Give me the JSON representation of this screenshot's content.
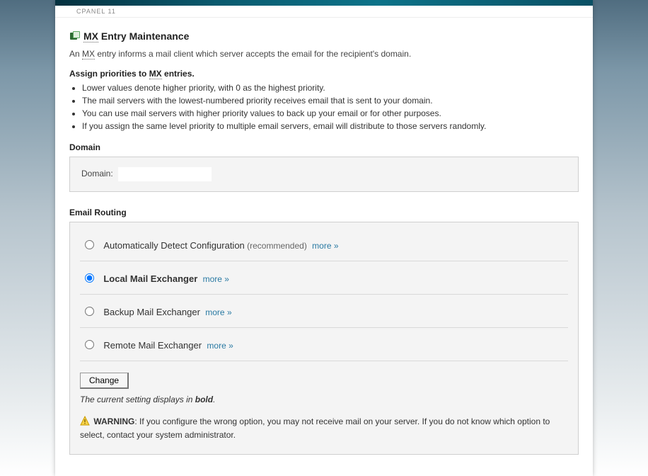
{
  "header": {
    "subbar": "CPANEL 11"
  },
  "title": {
    "prefix": "MX",
    "rest": " Entry Maintenance"
  },
  "intro": {
    "before": "An ",
    "mx": "MX",
    "after": " entry informs a mail client which server accepts the email for the recipient's domain."
  },
  "priorities": {
    "heading_before": "Assign priorities to ",
    "heading_mx": "MX",
    "heading_after": " entries.",
    "bullets": [
      "Lower values denote higher priority, with 0 as the highest priority.",
      "The mail servers with the lowest-numbered priority receives email that is sent to your domain.",
      "You can use mail servers with higher priority values to back up your email or for other purposes.",
      "If you assign the same level priority to multiple email servers, email will distribute to those servers randomly."
    ]
  },
  "domain": {
    "heading": "Domain",
    "label": "Domain:",
    "value": ""
  },
  "routing": {
    "heading": "Email Routing",
    "options": [
      {
        "label": "Automatically Detect Configuration",
        "suffix": "(recommended)",
        "more": "more »",
        "selected": false
      },
      {
        "label": "Local Mail Exchanger",
        "suffix": "",
        "more": "more »",
        "selected": true
      },
      {
        "label": "Backup Mail Exchanger",
        "suffix": "",
        "more": "more »",
        "selected": false
      },
      {
        "label": "Remote Mail Exchanger",
        "suffix": "",
        "more": "more »",
        "selected": false
      }
    ],
    "change_label": "Change",
    "note_before": "The current setting displays in ",
    "note_bold": "bold",
    "note_after": ".",
    "warning_label": "WARNING",
    "warning_text": ": If you configure the wrong option, you may not receive mail on your server. If you do not know which option to select, contact your system administrator."
  }
}
